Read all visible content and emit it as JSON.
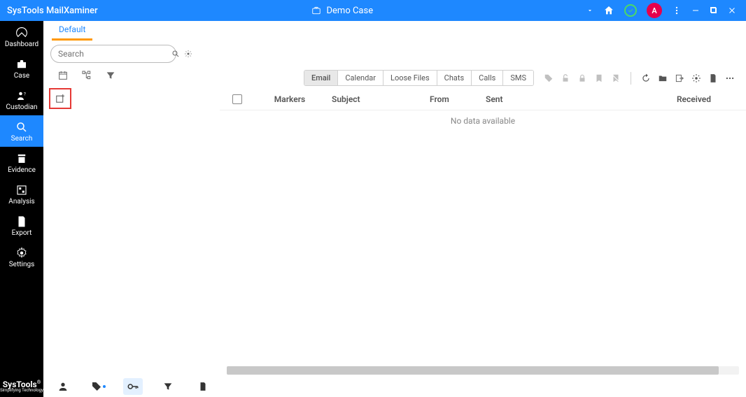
{
  "app": {
    "title": "SysTools MailXaminer"
  },
  "case": {
    "name": "Demo Case"
  },
  "user": {
    "avatar_letter": "A"
  },
  "sidebar": {
    "items": [
      {
        "label": "Dashboard"
      },
      {
        "label": "Case"
      },
      {
        "label": "Custodian"
      },
      {
        "label": "Search"
      },
      {
        "label": "Evidence"
      },
      {
        "label": "Analysis"
      },
      {
        "label": "Export"
      },
      {
        "label": "Settings"
      }
    ],
    "brand": "SysTools",
    "brand_tag": "Simplifying Technology"
  },
  "tabs": {
    "default_label": "Default"
  },
  "search": {
    "placeholder": "Search"
  },
  "filter_tabs": {
    "items": [
      {
        "label": "Email",
        "active": true
      },
      {
        "label": "Calendar"
      },
      {
        "label": "Loose Files"
      },
      {
        "label": "Chats"
      },
      {
        "label": "Calls"
      },
      {
        "label": "SMS"
      }
    ]
  },
  "columns": {
    "markers": "Markers",
    "subject": "Subject",
    "from": "From",
    "sent": "Sent",
    "received": "Received"
  },
  "table": {
    "empty_text": "No data available"
  }
}
